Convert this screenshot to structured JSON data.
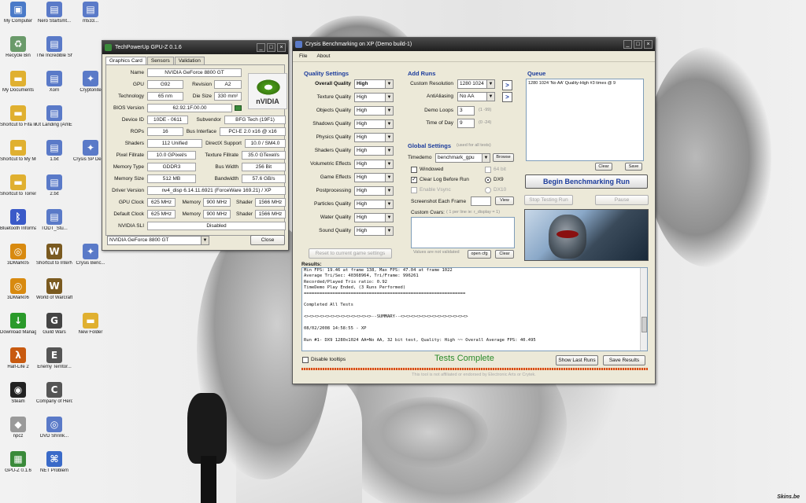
{
  "desktop": {
    "icons": [
      {
        "label": "My Computer",
        "icon": "computer-icon",
        "color": "#4a7ac8"
      },
      {
        "label": "Recycle Bin",
        "icon": "recycle-bin-icon",
        "color": "#6a9a6a"
      },
      {
        "label": "My Documents",
        "icon": "folder-icon",
        "color": "#e0b030"
      },
      {
        "label": "Shortcut to Fifa library",
        "icon": "folder-icon",
        "color": "#e0b030"
      },
      {
        "label": "Shortcut to My Music",
        "icon": "folder-icon",
        "color": "#e0b030"
      },
      {
        "label": "Shortcut to Torrents",
        "icon": "folder-icon",
        "color": "#e0b030"
      },
      {
        "label": "Bluetooth Informati...",
        "icon": "bluetooth-icon",
        "color": "#3a5ac8"
      },
      {
        "label": "3DMark05",
        "icon": "3dmark-icon",
        "color": "#d88a10"
      },
      {
        "label": "3DMark06",
        "icon": "3dmark-icon",
        "color": "#d88a10"
      },
      {
        "label": "Download Manager",
        "icon": "download-icon",
        "color": "#2a9a2a"
      },
      {
        "label": "Half-Life 2",
        "icon": "halflife-icon",
        "color": "#c85a10"
      },
      {
        "label": "Steam",
        "icon": "steam-icon",
        "color": "#222222"
      },
      {
        "label": "npcz",
        "icon": "drive-icon",
        "color": "#9a9a9a"
      },
      {
        "label": "GPU-Z 0.1.6",
        "icon": "gpu-icon",
        "color": "#3a8a3a"
      },
      {
        "label": "Nero Startsmt...",
        "icon": "document-icon",
        "color": "#5a7ac8"
      },
      {
        "label": "The Incredible Ship and...",
        "icon": "document-icon",
        "color": "#5a7ac8"
      },
      {
        "label": "Xorn",
        "icon": "document-icon",
        "color": "#5a7ac8"
      },
      {
        "label": "Ut Landing (AmEvoI...",
        "icon": "document-icon",
        "color": "#5a7ac8"
      },
      {
        "label": "1.txt",
        "icon": "document-icon",
        "color": "#5a7ac8"
      },
      {
        "label": "2.txt",
        "icon": "document-icon",
        "color": "#5a7ac8"
      },
      {
        "label": "TODT_Stu...",
        "icon": "document-icon",
        "color": "#5a7ac8"
      },
      {
        "label": "Shortcut to InterNet",
        "icon": "wow-icon",
        "color": "#7a5a20"
      },
      {
        "label": "World of Warcraft",
        "icon": "wow-icon",
        "color": "#7a5a20"
      },
      {
        "label": "Guild Wars",
        "icon": "guildwars-icon",
        "color": "#444444"
      },
      {
        "label": "Enemy Territor...",
        "icon": "et-icon",
        "color": "#555555"
      },
      {
        "label": "Company of Heroes",
        "icon": "coh-icon",
        "color": "#555555"
      },
      {
        "label": "DVD Shrink...",
        "icon": "dvd-icon",
        "color": "#5a7ac8"
      },
      {
        "label": "NET Problem",
        "icon": "network-icon",
        "color": "#3a6ac8"
      },
      {
        "label": "m533...",
        "icon": "document-icon",
        "color": "#5a7ac8"
      },
      {
        "label": "Cryptonite",
        "icon": "crysis-icon",
        "color": "#5a7ac8"
      },
      {
        "label": "Crysis SP Demo",
        "icon": "crysis-icon",
        "color": "#5a7ac8"
      },
      {
        "label": "Crysis Benc...",
        "icon": "crysis-icon",
        "color": "#5a7ac8"
      },
      {
        "label": "New Folder",
        "icon": "folder-icon",
        "color": "#e0b030"
      }
    ],
    "watermark": "Skins.be"
  },
  "gpuz": {
    "title": "TechPowerUp GPU-Z 0.1.6",
    "tabs": [
      "Graphics Card",
      "Sensors",
      "Validation"
    ],
    "rows": {
      "name": {
        "label": "Name",
        "value": "NVIDIA GeForce 8800 GT"
      },
      "gpu": {
        "label": "GPU",
        "value": "G92"
      },
      "revision": {
        "label": "Revision",
        "value": "A2"
      },
      "technology": {
        "label": "Technology",
        "value": "65 nm"
      },
      "die_size": {
        "label": "Die Size",
        "value": "330 mm²"
      },
      "bios": {
        "label": "BIOS Version",
        "value": "62.92.1F.00.00"
      },
      "device_id": {
        "label": "Device ID",
        "value": "10DE - 0611"
      },
      "subvendor": {
        "label": "Subvendor",
        "value": "BFG Tech (19F1)"
      },
      "rops": {
        "label": "ROPs",
        "value": "16"
      },
      "bus": {
        "label": "Bus Interface",
        "value": "PCI-E 2.0 x16 @ x16"
      },
      "shaders": {
        "label": "Shaders",
        "value": "112 Unified"
      },
      "directx": {
        "label": "DirectX Support",
        "value": "10.0 / SM4.0"
      },
      "pixel_fill": {
        "label": "Pixel Fillrate",
        "value": "10.0 GPixel/s"
      },
      "texture_fill": {
        "label": "Texture Fillrate",
        "value": "35.0 GTexel/s"
      },
      "mem_type": {
        "label": "Memory Type",
        "value": "GDDR3"
      },
      "bus_width": {
        "label": "Bus Width",
        "value": "256 Bit"
      },
      "mem_size": {
        "label": "Memory Size",
        "value": "512 MB"
      },
      "bandwidth": {
        "label": "Bandwidth",
        "value": "57.6 GB/s"
      },
      "driver": {
        "label": "Driver Version",
        "value": "nv4_disp 6.14.11.6921 (ForceWare 169.21) / XP"
      },
      "gpu_clock": {
        "label": "GPU Clock",
        "value": "625 MHz",
        "mem_label": "Memory",
        "mem": "900 MHz",
        "shader_label": "Shader",
        "shader": "1566 MHz"
      },
      "default_clock": {
        "label": "Default Clock",
        "value": "625 MHz",
        "mem_label": "Memory",
        "mem": "900 MHz",
        "shader_label": "Shader",
        "shader": "1566 MHz"
      },
      "sli": {
        "label": "NVIDIA SLI",
        "value": "Disabled"
      }
    },
    "logo_text": "nVIDIA",
    "card_select": "NVIDIA GeForce 8800 GT",
    "close_label": "Close"
  },
  "crysis": {
    "title": "Crysis Benchmarking on XP (Demo build-1)",
    "menu": [
      "File",
      "About"
    ],
    "quality": {
      "heading": "Quality Settings",
      "items": [
        {
          "label": "Overall Quality",
          "value": "High"
        },
        {
          "label": "Texture Quality",
          "value": "High"
        },
        {
          "label": "Objects Quality",
          "value": "High"
        },
        {
          "label": "Shadows Quality",
          "value": "High"
        },
        {
          "label": "Physics Quality",
          "value": "High"
        },
        {
          "label": "Shaders Quality",
          "value": "High"
        },
        {
          "label": "Volumetric Effects",
          "value": "High"
        },
        {
          "label": "Game Effects",
          "value": "High"
        },
        {
          "label": "Postprocessing",
          "value": "High"
        },
        {
          "label": "Particles Quality",
          "value": "High"
        },
        {
          "label": "Water Quality",
          "value": "High"
        },
        {
          "label": "Sound Quality",
          "value": "High"
        }
      ],
      "reset_label": "Reset to current game settings"
    },
    "add_runs": {
      "heading": "Add Runs",
      "resolution_label": "Custom Resolution",
      "resolution": "1280 1024",
      "aa_label": "AntiAliasing",
      "aa": "No AA",
      "loops_label": "Demo Loops",
      "loops": "3",
      "loops_hint": "(1 -99)",
      "tod_label": "Time of Day",
      "tod": "9",
      "tod_hint": "(0 -24)"
    },
    "queue": {
      "heading": "Queue",
      "items": [
        "1280 1024 'No AA' Quality-High #3 times @ 9"
      ],
      "clear_label": "Clear",
      "save_label": "Save"
    },
    "global": {
      "heading": "Global Settings",
      "hint": "(used for all tests)",
      "timedemo_label": "Timedemo",
      "timedemo": "benchmark_gpu",
      "browse_label": "Browse",
      "windowed_label": "Windowed",
      "bit64_label": "64 bit",
      "clearlog_label": "Clear Log Before Run",
      "dx9_label": "DX9",
      "vsync_label": "Enable Vsync",
      "dx10_label": "DX10",
      "screenshot_label": "Screenshot Each Frame",
      "view_label": "View",
      "cvars_label": "Custom Cvars:",
      "cvars_hint": "( 1 per line ie: r_display = 1)",
      "cvars_note": "Values are not validated",
      "open_cfg_label": "open cfg",
      "clear_label": "Clear"
    },
    "actions": {
      "begin_label": "Begin Benchmarking Run",
      "stop_label": "Stop Testing Run",
      "pause_label": "Pause"
    },
    "results": {
      "heading": "Results:",
      "lines": [
        "   Min FPS: 19.46 at frame 138, Max FPS: 47.04 at frame 1022",
        "   Average Tri/Sec: 40368964, Tri/Frame: 996261",
        "   Recorded/Played Tris ratio: 0.92",
        "TimeDemo Play Ended, (3 Runs Performed)",
        "==============================================================",
        "",
        "Completed All Tests",
        "",
        "<><><><><><><><><><><><><>--SUMMARY--<><><><><><><><><><><><><>",
        "",
        "08/02/2008 14:58:55 - XP",
        "",
        "Run #1- DX9 1280x1024 AA=No AA, 32 bit test, Quality: High ~~ Overall Average FPS: 40.495"
      ]
    },
    "footer": {
      "tooltips_label": "Disable tooltips",
      "status": "Tests Complete",
      "show_last_label": "Show Last Runs",
      "save_results_label": "Save Results",
      "disclaimer": "This tool is not affiliated or endorsed by Electronic Arts or Crytek."
    }
  }
}
